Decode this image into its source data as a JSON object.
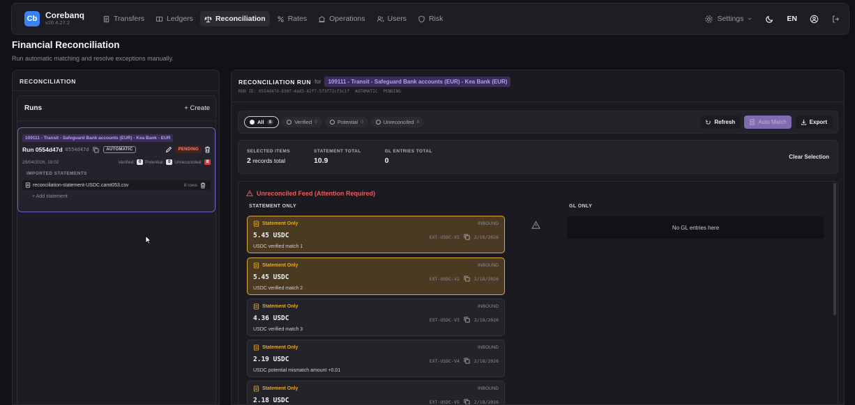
{
  "app": {
    "logo": "Cb",
    "name": "Corebanq",
    "version": "v26.4.27.2"
  },
  "nav": {
    "items": [
      {
        "label": "Transfers",
        "icon": "file-icon"
      },
      {
        "label": "Ledgers",
        "icon": "book-icon"
      },
      {
        "label": "Reconciliation",
        "icon": "scale-icon",
        "active": true
      },
      {
        "label": "Rates",
        "icon": "percent-icon"
      },
      {
        "label": "Operations",
        "icon": "operations-icon"
      },
      {
        "label": "Users",
        "icon": "users-icon"
      },
      {
        "label": "Risk",
        "icon": "shield-icon"
      }
    ],
    "settings": "Settings",
    "lang": "EN"
  },
  "page": {
    "title": "Financial Reconciliation",
    "subtitle": "Run automatic matching and resolve exceptions manually."
  },
  "left": {
    "heading": "RECONCILIATION",
    "runs_label": "Runs",
    "create_label": "+ Create",
    "run": {
      "account_tag": "109111 - Transit - Safeguard Bank accounts (EUR) - Kea Bank - EUR",
      "name": "Run 0554d47d",
      "short_id": "0554d47d",
      "mode": "AUTOMATIC",
      "status": "PENDING",
      "date": "29/04/2026, 19:02",
      "verified_label": "Verified:",
      "verified": "0",
      "potential_label": "Potential:",
      "potential": "0",
      "unreconciled_label": "Unreconciled:",
      "unreconciled": "8",
      "imported_heading": "IMPORTED STATEMENTS",
      "file": "reconciliation-statement-USDC.camt053.csv",
      "file_rows": "8 rows",
      "add_statement": "+ Add statement"
    }
  },
  "run_panel": {
    "title": "RECONCILIATION RUN",
    "for": "for",
    "account": "109111 - Transit - Safeguard Bank accounts (EUR) - Kea Bank (EUR)",
    "run_id": "RUN ID: 0554d47d-830f-4ad3-82f7-5f3f72cf3c1f",
    "mode": "AUTOMATIC",
    "status": "PENDING"
  },
  "filters": [
    {
      "label": "All",
      "count": "8",
      "active": true
    },
    {
      "label": "Verified",
      "count": "0"
    },
    {
      "label": "Potential",
      "count": "0"
    },
    {
      "label": "Unreconciled",
      "count": "8"
    }
  ],
  "actions": {
    "refresh": "Refresh",
    "auto_match": "Auto Match",
    "export": "Export"
  },
  "selection": {
    "items_label": "SELECTED ITEMS",
    "items_count": "2",
    "items_suffix": "records total",
    "statement_label": "STATEMENT TOTAL",
    "statement_total": "10.9",
    "gl_label": "GL ENTRIES TOTAL",
    "gl_total": "0",
    "clear": "Clear Selection"
  },
  "feed": {
    "title": "Unreconciled Feed (Attention Required)",
    "statement_col": "STATEMENT ONLY",
    "gl_col": "GL ONLY",
    "gl_empty": "No GL entries here",
    "cards": [
      {
        "type": "Statement Only",
        "dir": "INBOUND",
        "amount": "5.45 USDC",
        "ref": "EXT-USDC-V1",
        "date": "2/18/2026",
        "desc": "USDC verified match 1",
        "selected": true
      },
      {
        "type": "Statement Only",
        "dir": "INBOUND",
        "amount": "5.45 USDC",
        "ref": "EXT-USDC-V2",
        "date": "2/18/2026",
        "desc": "USDC verified match 2",
        "selected": true
      },
      {
        "type": "Statement Only",
        "dir": "INBOUND",
        "amount": "4.36 USDC",
        "ref": "EXT-USDC-V3",
        "date": "2/18/2026",
        "desc": "USDC verified match 3",
        "selected": false
      },
      {
        "type": "Statement Only",
        "dir": "INBOUND",
        "amount": "2.19 USDC",
        "ref": "EXT-USDC-V4",
        "date": "2/18/2026",
        "desc": "USDC potential mismatch amount +0.01",
        "selected": false
      },
      {
        "type": "Statement Only",
        "dir": "INBOUND",
        "amount": "2.18 USDC",
        "ref": "EXT-USDC-V5",
        "date": "2/18/2026",
        "desc": "",
        "selected": false
      }
    ]
  },
  "colors": {
    "accent": "#8e78c9",
    "warning": "#e0a83a",
    "danger": "#ee5a5a",
    "bg": "#121116"
  }
}
